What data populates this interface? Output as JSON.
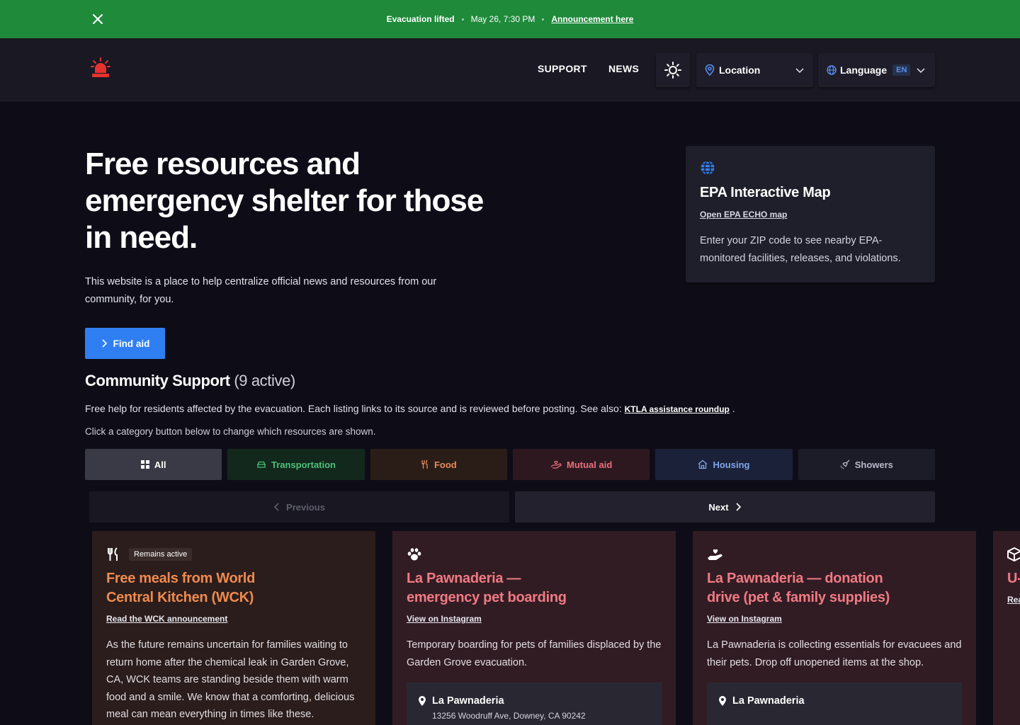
{
  "banner": {
    "status": "Evacuation lifted",
    "datetime": "May 26, 7:30 PM",
    "link": "Announcement here",
    "color": "#1e8a3a"
  },
  "header": {
    "nav": {
      "support": "SUPPORT",
      "news": "NEWS"
    },
    "location": {
      "label": "Location"
    },
    "language": {
      "label": "Language",
      "code": "EN"
    }
  },
  "hero": {
    "title": "Free resources and emergency shelter for those in need.",
    "subtitle": "This website is a place to help centralize official news and resources from our community, for you.",
    "cta": "Find aid"
  },
  "epa": {
    "title": "EPA Interactive Map",
    "link": "Open EPA ECHO map",
    "description": "Enter your ZIP code to see nearby EPA-monitored facilities, releases, and violations."
  },
  "community": {
    "title": "Community Support",
    "count": "(9 active)",
    "description": "Free help for residents affected by the evacuation. Each listing links to its source and is reviewed before posting. See also:",
    "link": "KTLA assistance roundup",
    "period": ".",
    "hint": "Click a category button below to change which resources are shown.",
    "categories": [
      {
        "label": "All",
        "icon": "grid-icon"
      },
      {
        "label": "Transportation",
        "icon": "car-icon"
      },
      {
        "label": "Food",
        "icon": "utensils-icon"
      },
      {
        "label": "Mutual aid",
        "icon": "hand-heart-icon"
      },
      {
        "label": "Housing",
        "icon": "house-icon"
      },
      {
        "label": "Showers",
        "icon": "shower-icon"
      }
    ],
    "pager": {
      "previous": "Previous",
      "next": "Next"
    }
  },
  "cards": [
    {
      "icon": "utensils-icon",
      "badge": "Remains active",
      "title": "Free meals from World Central Kitchen (WCK)",
      "link": "Read the WCK announcement",
      "description": "As the future remains uncertain for families waiting to return home after the chemical leak in Garden Grove, CA, WCK teams are standing beside them with warm food and a smile. We know that a comforting, delicious meal can mean everything in times like these."
    },
    {
      "icon": "paw-icon",
      "title": "La Pawnaderia — emergency pet boarding",
      "link": "View on Instagram",
      "description": "Temporary boarding for pets of families displaced by the Garden Grove evacuation.",
      "location": {
        "name": "La Pawnaderia",
        "address": "13256 Woodruff Ave, Downey, CA 90242"
      }
    },
    {
      "icon": "hand-heart-icon",
      "title": "La Pawnaderia — donation drive (pet & family supplies)",
      "link": "View on Instagram",
      "description": "La Pawnaderia is collecting essentials for evacuees and their pets. Drop off unopened items at the shop.",
      "location": {
        "name": "La Pawnaderia"
      }
    },
    {
      "icon": "box-icon",
      "title": "U-",
      "link": "Rea"
    }
  ]
}
